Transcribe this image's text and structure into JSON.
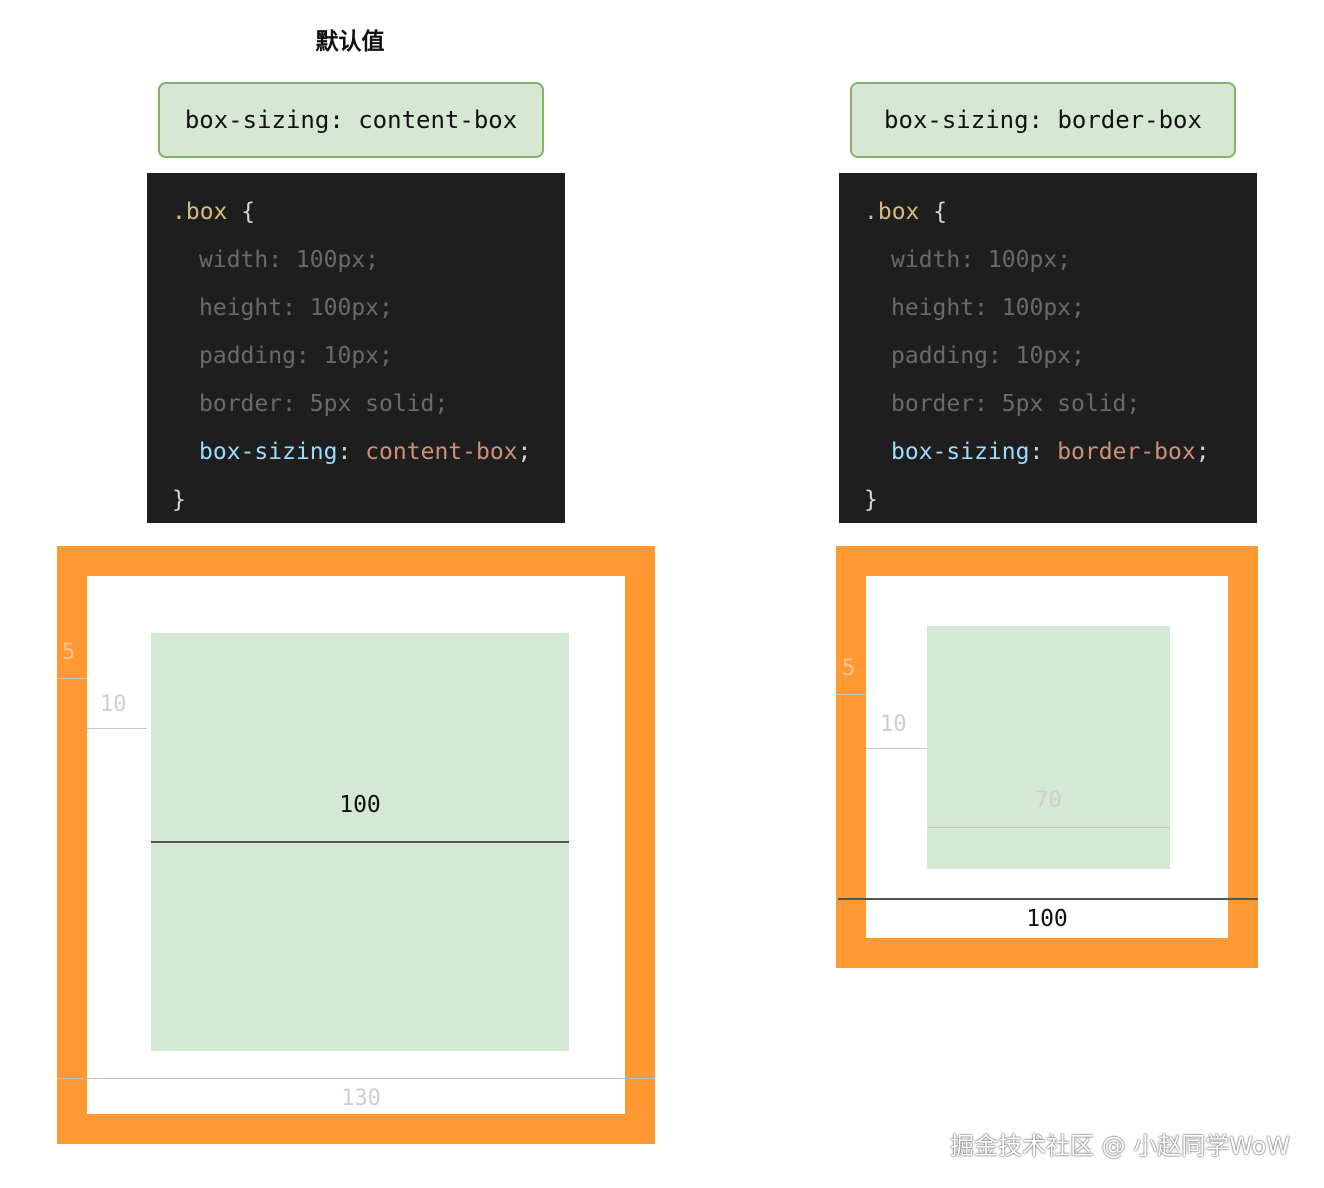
{
  "heading": "默认值",
  "left": {
    "label": "box-sizing: content-box",
    "code": {
      "selector": ".box",
      "open": "{",
      "close": "}",
      "width": "width: 100px;",
      "height": "height: 100px;",
      "padding": "padding: 10px;",
      "border": "border: 5px solid;",
      "sizing_prop": "box-sizing",
      "sizing_colon": ":",
      "sizing_value": "content-box",
      "sizing_semi": ";"
    },
    "dims": {
      "border": "5",
      "padding": "10",
      "content": "100",
      "total": "130"
    }
  },
  "right": {
    "label": "box-sizing: border-box",
    "code": {
      "selector": ".box",
      "open": "{",
      "close": "}",
      "width": "width: 100px;",
      "height": "height: 100px;",
      "padding": "padding: 10px;",
      "border": "border: 5px solid;",
      "sizing_prop": "box-sizing",
      "sizing_colon": ":",
      "sizing_value": "border-box",
      "sizing_semi": ";"
    },
    "dims": {
      "border": "5",
      "padding": "10",
      "content": "70",
      "total": "100"
    }
  },
  "watermark": "掘金技术社区 @ 小赵同学WoW",
  "colors": {
    "border": "#ff9a33",
    "padding": "#ffffff",
    "content": "#d5e8d4",
    "label_fill": "#d6e8d4",
    "label_stroke": "#82b366",
    "code_bg": "#1e1e1e"
  }
}
